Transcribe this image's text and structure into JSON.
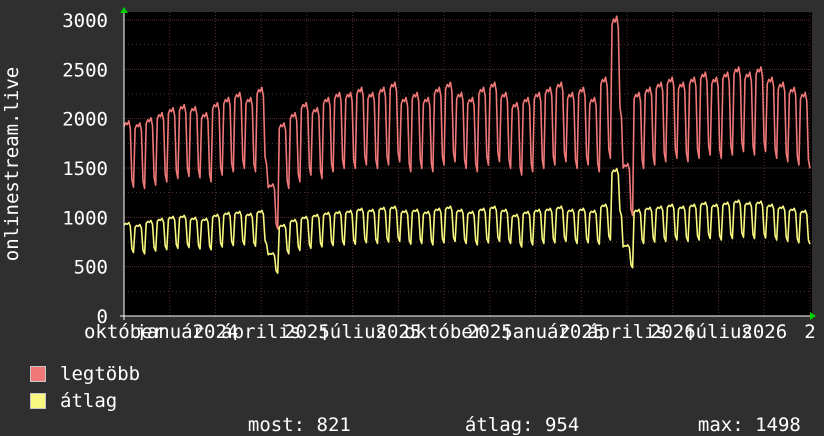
{
  "chart_data": {
    "type": "line",
    "ylabel": "onlinestream.live",
    "ylim": [
      0,
      3000
    ],
    "yticks": [
      0,
      500,
      1000,
      1500,
      2000,
      2500,
      3000
    ],
    "xticks": [
      "október",
      "január",
      "2024",
      "április",
      "2025",
      "július",
      "2025",
      "október",
      "2025",
      "január",
      "2025",
      "április",
      "2026",
      "július",
      "2026",
      "2"
    ],
    "grid": true,
    "colors": {
      "background": "#2f2f2f",
      "plot": "#000000",
      "grid": "#5a3030",
      "axis": "#ffffff",
      "legend_border": "#c8c8c8"
    },
    "series": [
      {
        "name": "legtöbb",
        "color": "#f07878",
        "points_per_week": 7,
        "pattern": [
          1.0,
          1.02,
          1.01,
          1.03,
          0.99,
          0.72,
          0.68
        ],
        "weekly": [
          1920,
          1900,
          1950,
          2000,
          2050,
          2080,
          2060,
          2000,
          2100,
          2150,
          2200,
          2150,
          2250,
          1300,
          1900,
          2000,
          2100,
          2050,
          2150,
          2200,
          2200,
          2250,
          2200,
          2250,
          2300,
          2150,
          2200,
          2150,
          2250,
          2300,
          2200,
          2150,
          2250,
          2300,
          2200,
          2100,
          2150,
          2200,
          2250,
          2300,
          2200,
          2250,
          2150,
          2350,
          2950,
          1500,
          2200,
          2250,
          2300,
          2350,
          2300,
          2350,
          2400,
          2350,
          2400,
          2450,
          2400,
          2450,
          2350,
          2300,
          2250,
          2200
        ]
      },
      {
        "name": "átlag",
        "color": "#f8f880",
        "points_per_week": 7,
        "pattern": [
          1.0,
          1.02,
          1.01,
          1.03,
          0.99,
          0.74,
          0.7
        ],
        "weekly": [
          920,
          900,
          940,
          960,
          980,
          990,
          970,
          960,
          1000,
          1020,
          1030,
          1010,
          1040,
          620,
          900,
          950,
          980,
          1000,
          1020,
          1030,
          1040,
          1060,
          1050,
          1070,
          1080,
          1040,
          1050,
          1030,
          1060,
          1080,
          1050,
          1030,
          1060,
          1080,
          1050,
          1000,
          1030,
          1050,
          1060,
          1080,
          1050,
          1060,
          1040,
          1100,
          1450,
          700,
          1050,
          1070,
          1080,
          1100,
          1080,
          1100,
          1120,
          1100,
          1120,
          1140,
          1120,
          1130,
          1100,
          1080,
          1060,
          1040
        ]
      }
    ]
  },
  "legend": [
    {
      "label": "legtöbb",
      "color": "#f07878"
    },
    {
      "label": "átlag",
      "color": "#f8f880"
    }
  ],
  "stats": {
    "now_label": "most:",
    "now_value": "821",
    "avg_label": "átlag:",
    "avg_value": "954",
    "max_label": "max:",
    "max_value": "1498"
  }
}
